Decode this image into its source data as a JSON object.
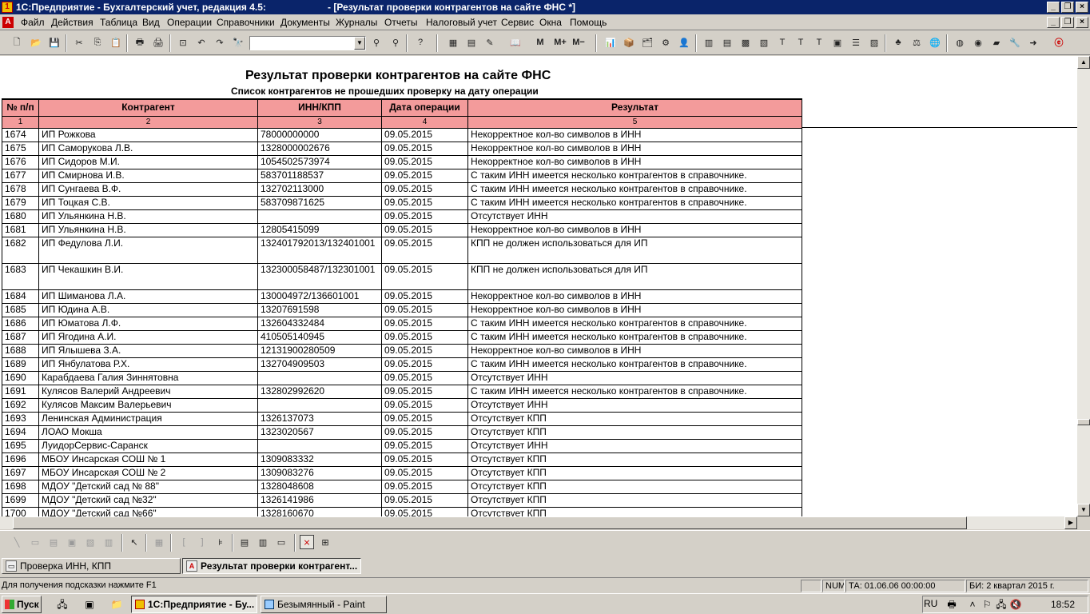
{
  "window": {
    "app_title": "1С:Предприятие - Бухгалтерский учет, редакция 4.5:",
    "doc_title": "- [Результат проверки контрагентов на сайте ФНС  *]"
  },
  "menu": [
    "Файл",
    "Действия",
    "Таблица",
    "Вид",
    "Операции",
    "Справочники",
    "Документы",
    "Журналы",
    "Отчеты",
    "Налоговый учет",
    "Сервис",
    "Окна",
    "Помощь"
  ],
  "report": {
    "title": "Результат проверки контрагентов на сайте ФНС",
    "subtitle": "Список контрагентов не прошедших проверку на дату операции",
    "headers": [
      "№ п/п",
      "Контрагент",
      "ИНН/КПП",
      "Дата операции",
      "Результат"
    ],
    "col_numbers": [
      "1",
      "2",
      "3",
      "4",
      "5"
    ],
    "rows": [
      {
        "n": "1674",
        "name": "ИП Рожкова",
        "inn": "78000000000",
        "date": "09.05.2015",
        "result": "Некорректное кол-во символов в ИНН"
      },
      {
        "n": "1675",
        "name": "ИП Саморукова Л.В.",
        "inn": "1328000002676",
        "date": "09.05.2015",
        "result": "Некорректное кол-во символов в ИНН"
      },
      {
        "n": "1676",
        "name": "ИП Сидоров М.И.",
        "inn": "1054502573974",
        "date": "09.05.2015",
        "result": "Некорректное кол-во символов в ИНН"
      },
      {
        "n": "1677",
        "name": "ИП Смирнова И.В.",
        "inn": "583701188537",
        "date": "09.05.2015",
        "result": "С таким ИНН имеется несколько контрагентов в справочнике."
      },
      {
        "n": "1678",
        "name": "ИП Сунгаева В.Ф.",
        "inn": "132702113000",
        "date": "09.05.2015",
        "result": "С таким ИНН имеется несколько контрагентов в справочнике."
      },
      {
        "n": "1679",
        "name": "ИП Тоцкая С.В.",
        "inn": "583709871625",
        "date": "09.05.2015",
        "result": "С таким ИНН имеется несколько контрагентов в справочнике."
      },
      {
        "n": "1680",
        "name": "ИП Ульянкина Н.В.",
        "inn": "",
        "date": "09.05.2015",
        "result": "Отсутствует ИНН"
      },
      {
        "n": "1681",
        "name": "ИП Ульянкина Н.В.",
        "inn": "12805415099",
        "date": "09.05.2015",
        "result": "Некорректное кол-во символов в ИНН"
      },
      {
        "n": "1682",
        "name": "ИП Федулова Л.И.",
        "inn": "132401792013/132401001",
        "date": "09.05.2015",
        "result": "КПП не должен использоваться для ИП"
      },
      {
        "n": "1683",
        "name": "ИП Чекашкин В.И.",
        "inn": "132300058487/132301001",
        "date": "09.05.2015",
        "result": "КПП не должен использоваться для ИП"
      },
      {
        "n": "1684",
        "name": "ИП Шиманова Л.А.",
        "inn": "130004972/136601001",
        "date": "09.05.2015",
        "result": "Некорректное кол-во символов в ИНН"
      },
      {
        "n": "1685",
        "name": "ИП Юдина А.В.",
        "inn": "13207691598",
        "date": "09.05.2015",
        "result": "Некорректное кол-во символов в ИНН"
      },
      {
        "n": "1686",
        "name": "ИП Юматова Л.Ф.",
        "inn": "132604332484",
        "date": "09.05.2015",
        "result": "С таким ИНН имеется несколько контрагентов в справочнике."
      },
      {
        "n": "1687",
        "name": "ИП Ягодина А.И.",
        "inn": "410505140945",
        "date": "09.05.2015",
        "result": "С таким ИНН имеется несколько контрагентов в справочнике."
      },
      {
        "n": "1688",
        "name": "ИП Ялышева З.А.",
        "inn": "12131900280509",
        "date": "09.05.2015",
        "result": "Некорректное кол-во символов в ИНН"
      },
      {
        "n": "1689",
        "name": "ИП Янбулатова Р.Х.",
        "inn": "132704909503",
        "date": "09.05.2015",
        "result": "С таким ИНН имеется несколько контрагентов в справочнике."
      },
      {
        "n": "1690",
        "name": "Карабдаева Галия Зиннятовна",
        "inn": "",
        "date": "09.05.2015",
        "result": "Отсутствует ИНН"
      },
      {
        "n": "1691",
        "name": "Кулясов Валерий Андреевич",
        "inn": "132802992620",
        "date": "09.05.2015",
        "result": "С таким ИНН имеется несколько контрагентов в справочнике."
      },
      {
        "n": "1692",
        "name": "Кулясов Максим  Валерьевич",
        "inn": "",
        "date": "09.05.2015",
        "result": "Отсутствует ИНН"
      },
      {
        "n": "1693",
        "name": "Ленинская Администрация",
        "inn": "1326137073",
        "date": "09.05.2015",
        "result": "Отсутствует КПП"
      },
      {
        "n": "1694",
        "name": "ЛОАО Мокша",
        "inn": "1323020567",
        "date": "09.05.2015",
        "result": "Отсутствует КПП"
      },
      {
        "n": "1695",
        "name": "ЛуидорСервис-Саранск",
        "inn": "",
        "date": "09.05.2015",
        "result": "Отсутствует ИНН"
      },
      {
        "n": "1696",
        "name": "МБОУ Инсарская СОШ № 1",
        "inn": "1309083332",
        "date": "09.05.2015",
        "result": "Отсутствует КПП"
      },
      {
        "n": "1697",
        "name": "МБОУ Инсарская СОШ № 2",
        "inn": "1309083276",
        "date": "09.05.2015",
        "result": "Отсутствует КПП"
      },
      {
        "n": "1698",
        "name": "МДОУ \"Детский сад № 88\"",
        "inn": "1328048608",
        "date": "09.05.2015",
        "result": "Отсутствует КПП"
      },
      {
        "n": "1699",
        "name": "МДОУ \"Детский сад №32\"",
        "inn": "1326141986",
        "date": "09.05.2015",
        "result": "Отсутствует КПП"
      },
      {
        "n": "1700",
        "name": "МДОУ \"Детский сад №66\"",
        "inn": "1328160670",
        "date": "09.05.2015",
        "result": "Отсутствует КПП"
      }
    ]
  },
  "tabs": [
    "Проверка ИНН, КПП",
    "Результат проверки контрагент..."
  ],
  "status": {
    "hint": "Для получения подсказки нажмите F1",
    "num": "NUM",
    "ta": "ТА: 01.06.06  00:00:00",
    "bi": "БИ: 2 квартал 2015 г."
  },
  "taskbar": {
    "start": "Пуск",
    "tasks": [
      "1С:Предприятие - Бу...",
      "Безымянный - Paint"
    ],
    "lang": "RU",
    "clock": "18:52"
  }
}
